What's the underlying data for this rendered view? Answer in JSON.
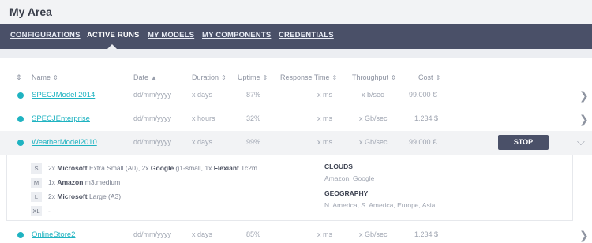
{
  "page": {
    "title": "My Area"
  },
  "nav": {
    "tabs": [
      {
        "label": "CONFIGURATIONS"
      },
      {
        "label": "ACTIVE RUNS"
      },
      {
        "label": "MY MODELS"
      },
      {
        "label": "MY COMPONENTS"
      },
      {
        "label": "CREDENTIALS"
      }
    ],
    "active_tab": "ACTIVE RUNS"
  },
  "table": {
    "columns": [
      "Name",
      "Date",
      "Duration",
      "Uptime",
      "Response Time",
      "Throughput",
      "Cost"
    ],
    "sort_icons": {
      "neutral": "⇕",
      "ascending": "▲"
    },
    "rows": [
      {
        "name": "SPECJModel 2014",
        "date": "dd/mm/yyyy",
        "duration": "x days",
        "uptime": "87%",
        "response_time": "x ms",
        "throughput": "x b/sec",
        "cost": "99.000 €"
      },
      {
        "name": "SPECJEnterprise",
        "date": "dd/mm/yyyy",
        "duration": "x hours",
        "uptime": "32%",
        "response_time": "x ms",
        "throughput": "x Gb/sec",
        "cost": "1.234 $"
      },
      {
        "name": "WeatherModel2010",
        "date": "dd/mm/yyyy",
        "duration": "x days",
        "uptime": "99%",
        "response_time": "x ms",
        "throughput": "x Gb/sec",
        "cost": "99.000 €",
        "action": "STOP"
      },
      {
        "name": "OnlineStore2",
        "date": "dd/mm/yyyy",
        "duration": "x days",
        "uptime": "85%",
        "response_time": "x ms",
        "throughput": "x Gb/sec",
        "cost": "1.234 $"
      }
    ]
  },
  "details": {
    "resources": [
      {
        "size": "S",
        "text_parts": [
          "2x ",
          "Microsoft",
          " Extra Small (A0), 2x ",
          "Google",
          " g1-small, 1x ",
          "Flexiant",
          " 1c2m"
        ]
      },
      {
        "size": "M",
        "text_parts": [
          "1x ",
          "Amazon",
          " m3.medium"
        ]
      },
      {
        "size": "L",
        "text_parts": [
          "2x ",
          "Microsoft",
          " Large (A3)"
        ]
      },
      {
        "size": "XL",
        "text_parts": [
          "-"
        ]
      }
    ],
    "clouds_heading": "CLOUDS",
    "clouds_value": "Amazon, Google",
    "geography_heading": "GEOGRAPHY",
    "geography_value": "N. America, S. America, Europe, Asia"
  },
  "colors": {
    "accent": "#1fb3c1",
    "nav_bg": "#4a5068",
    "status_running": "#1fb3c1"
  },
  "icons": {
    "row_expand": "chevron-right-icon",
    "row_collapse": "chevron-down-icon",
    "status": "status-dot-icon"
  }
}
